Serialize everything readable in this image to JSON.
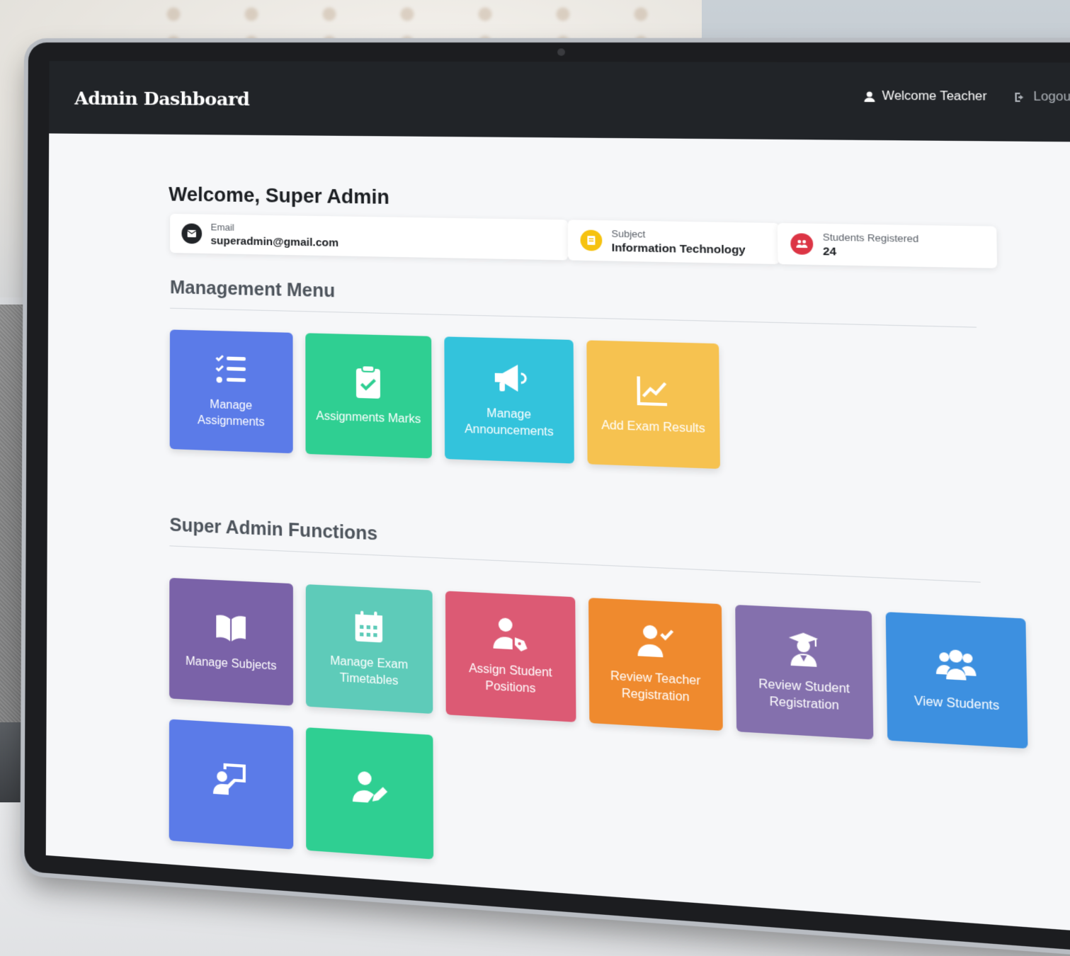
{
  "navbar": {
    "brand": "Admin Dashboard",
    "welcome_label": "Welcome Teacher",
    "logout_label": "Logout"
  },
  "header": {
    "welcome_title": "Welcome, Super Admin"
  },
  "info_cards": [
    {
      "label": "Email",
      "value": "superadmin@gmail.com",
      "icon": "envelope-icon",
      "color": "#212428"
    },
    {
      "label": "Subject",
      "value": "Information Technology",
      "icon": "book-icon",
      "color": "#f6c20f"
    },
    {
      "label": "Students Registered",
      "value": "24",
      "icon": "users-icon",
      "color": "#dc3545"
    }
  ],
  "management_menu": {
    "title": "Management Menu",
    "items": [
      {
        "label": "Manage Assignments",
        "icon": "list-check-icon",
        "color": "#5b7be8"
      },
      {
        "label": "Assignments Marks",
        "icon": "clipboard-check-icon",
        "color": "#2fcf92"
      },
      {
        "label": "Manage Announcements",
        "icon": "megaphone-icon",
        "color": "#33c3dc"
      },
      {
        "label": "Add Exam Results",
        "icon": "chart-line-icon",
        "color": "#f6c250"
      }
    ]
  },
  "super_admin_functions": {
    "title": "Super Admin Functions",
    "items": [
      {
        "label": "Manage Subjects",
        "icon": "open-book-icon",
        "color": "#7a62a8"
      },
      {
        "label": "Manage Exam Timetables",
        "icon": "calendar-icon",
        "color": "#5ecbb9"
      },
      {
        "label": "Assign Student Positions",
        "icon": "user-tag-icon",
        "color": "#dc5a74"
      },
      {
        "label": "Review Teacher Registration",
        "icon": "user-check-icon",
        "color": "#ef8a2e"
      },
      {
        "label": "Review Student Registration",
        "icon": "graduation-user-icon",
        "color": "#8470ad"
      },
      {
        "label": "View Students",
        "icon": "users-group-icon",
        "color": "#3d90e0"
      },
      {
        "label": "",
        "icon": "teacher-board-icon",
        "color": "#5b7be8"
      },
      {
        "label": "",
        "icon": "user-edit-icon",
        "color": "#2fcf92"
      }
    ]
  }
}
